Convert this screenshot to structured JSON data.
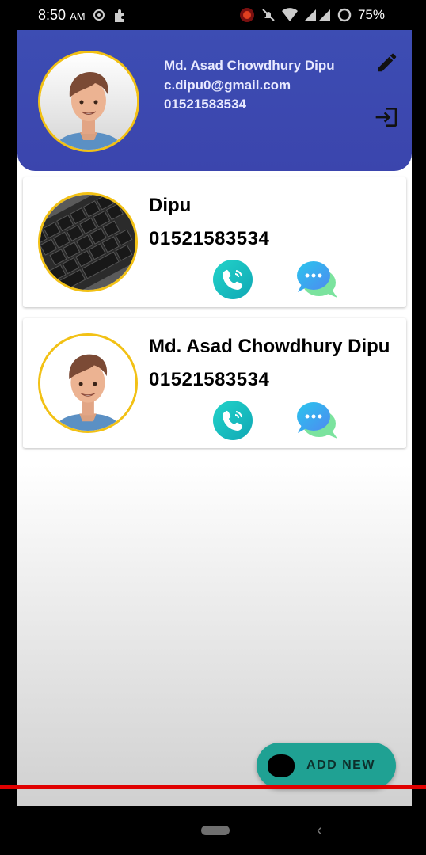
{
  "status_bar": {
    "time": "8:50",
    "ampm": "AM",
    "battery": "75%"
  },
  "header": {
    "user_name": "Md. Asad Chowdhury Dipu",
    "email": "c.dipu0@gmail.com",
    "phone": "01521583534",
    "edit_icon": "pencil-icon",
    "logout_icon": "login-arrow-icon"
  },
  "contacts": [
    {
      "name": "Dipu",
      "phone": "01521583534",
      "avatar": "keyboard-photo"
    },
    {
      "name": "Md. Asad Chowdhury Dipu",
      "phone": "01521583534",
      "avatar": "man-illustration"
    }
  ],
  "fab": {
    "label": "ADD NEW"
  },
  "colors": {
    "header": "#3d4db3",
    "avatar_ring": "#f2c115",
    "call_button": "#1bbfc4",
    "fab": "#1fa193"
  }
}
